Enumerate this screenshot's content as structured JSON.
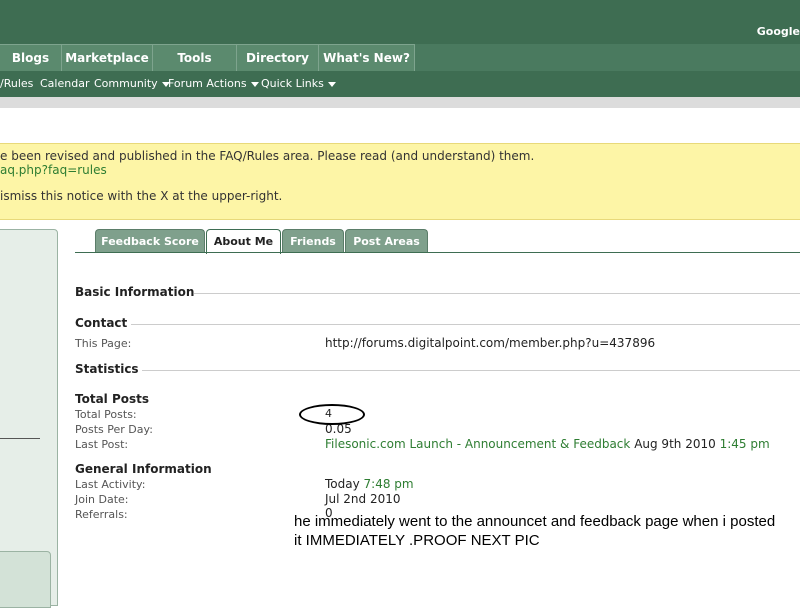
{
  "header": {
    "google_text": "Google"
  },
  "nav": {
    "tabs": [
      "Blogs",
      "Marketplace",
      "Tools",
      "Directory",
      "What's New?"
    ]
  },
  "subnav": {
    "items": [
      "/Rules",
      "Calendar",
      "Community",
      "Forum Actions",
      "Quick Links"
    ]
  },
  "notice": {
    "line1": "e been revised and published in the FAQ/Rules area. Please read (and understand) them.",
    "line2": "aq.php?faq=rules",
    "line3": "ismiss this notice with the X at the upper-right."
  },
  "profile": {
    "tabs": [
      "Feedback Score",
      "About Me",
      "Friends",
      "Post Areas"
    ],
    "active_tab": "About Me",
    "basic_information": "Basic Information",
    "contact": {
      "heading": "Contact",
      "this_page_label": "This Page:",
      "this_page_value": "http://forums.digitalpoint.com/member.php?u=437896"
    },
    "statistics": {
      "heading": "Statistics",
      "total_posts_heading": "Total Posts",
      "total_posts_label": "Total Posts:",
      "total_posts_value": "4",
      "posts_per_day_label": "Posts Per Day:",
      "posts_per_day_value": "0.05",
      "last_post_label": "Last Post:",
      "last_post_link": "Filesonic.com Launch - Announcement & Feedback",
      "last_post_date": "Aug 9th 2010",
      "last_post_time": "1:45 pm",
      "general_information_heading": "General Information",
      "last_activity_label": "Last Activity:",
      "last_activity_day": "Today",
      "last_activity_time": "7:48 pm",
      "join_date_label": "Join Date:",
      "join_date_value": "Jul 2nd 2010",
      "referrals_label": "Referrals:",
      "referrals_value": "0"
    }
  },
  "annotation": {
    "line1": "he immediately went to the announcet and feedback page when i posted",
    "line2": "it IMMEDIATELY .PROOF NEXT PIC"
  },
  "colors": {
    "header_green": "#3e6d52",
    "link_green": "#2e7d32",
    "notice_yellow": "#fdf5a6"
  }
}
